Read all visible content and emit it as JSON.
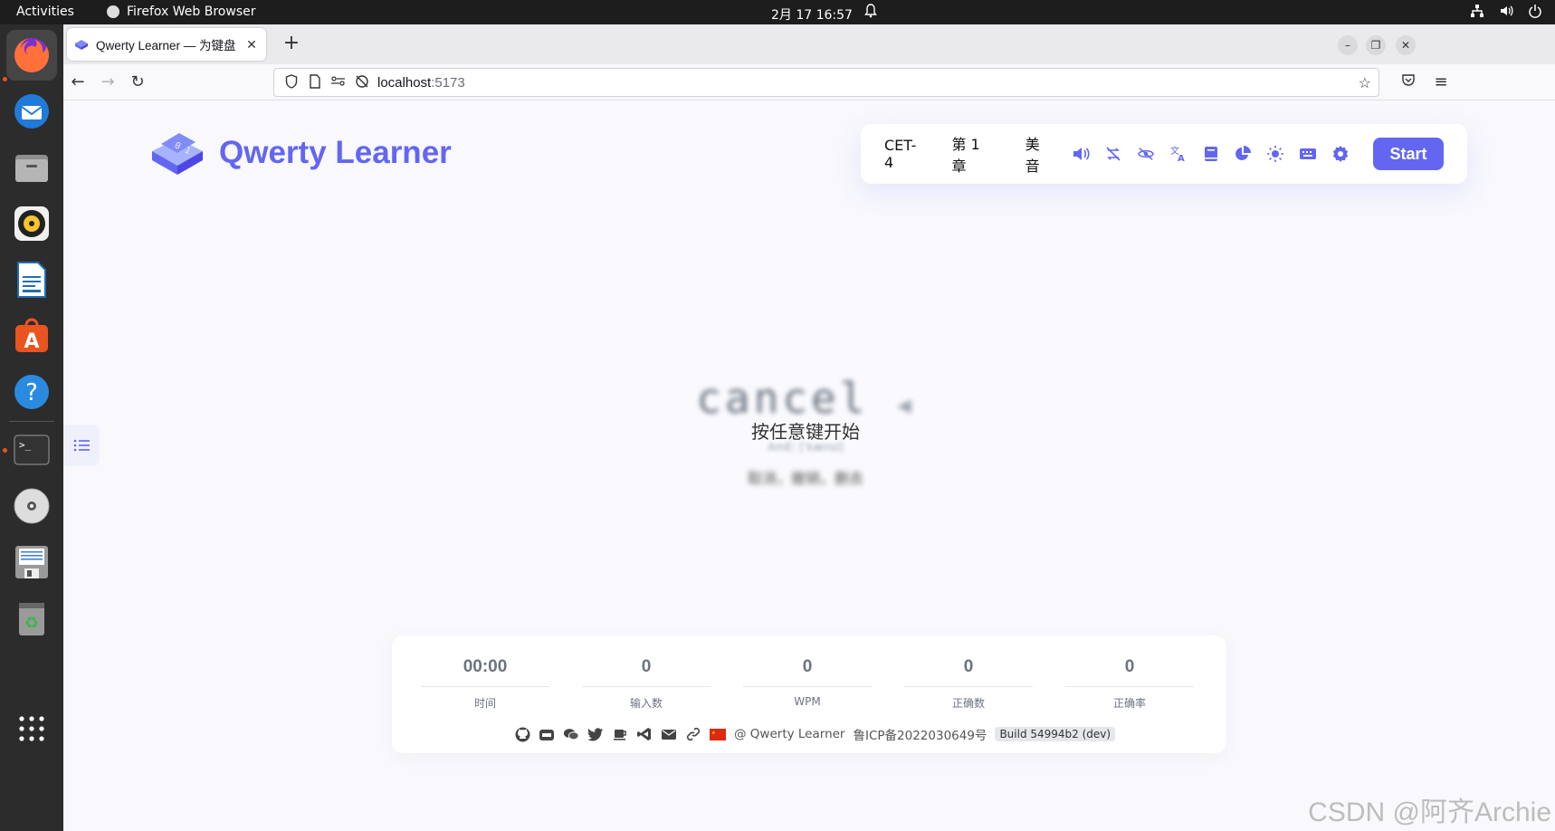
{
  "topbar": {
    "activities": "Activities",
    "app_name": "Firefox Web Browser",
    "clock": "2月 17  16:57"
  },
  "dock": {
    "apps": [
      "firefox-icon",
      "thunderbird-icon",
      "files-icon",
      "rhythmbox-icon",
      "writer-icon",
      "app-center-icon",
      "help-icon",
      "terminal-icon",
      "dvd-icon",
      "save-icon",
      "trash-icon",
      "app-grid-icon"
    ]
  },
  "browser": {
    "tab_title": "Qwerty Learner — 为键盘",
    "url_host": "localhost",
    "url_port": ":5173"
  },
  "app": {
    "logo_text": "Qwerty Learner",
    "dict": "CET-4",
    "chapter": "第 1 章",
    "pronunciation": "美音",
    "start_label": "Start",
    "accent": "#6366f1"
  },
  "word": {
    "text": "cancel",
    "hint": "按任意键开始",
    "phonetic": "AmE: [ˈkænsl]",
    "translation": "取消，撤销，删去"
  },
  "stats": [
    {
      "value": "00:00",
      "label": "时间"
    },
    {
      "value": "0",
      "label": "输入数"
    },
    {
      "value": "0",
      "label": "WPM"
    },
    {
      "value": "0",
      "label": "正确数"
    },
    {
      "value": "0",
      "label": "正确率"
    }
  ],
  "footer": {
    "author": "@ Qwerty Learner",
    "icp": "鲁ICP备2022030649号",
    "build": "Build 54994b2 (dev)"
  },
  "watermark": "CSDN @阿齐Archie"
}
